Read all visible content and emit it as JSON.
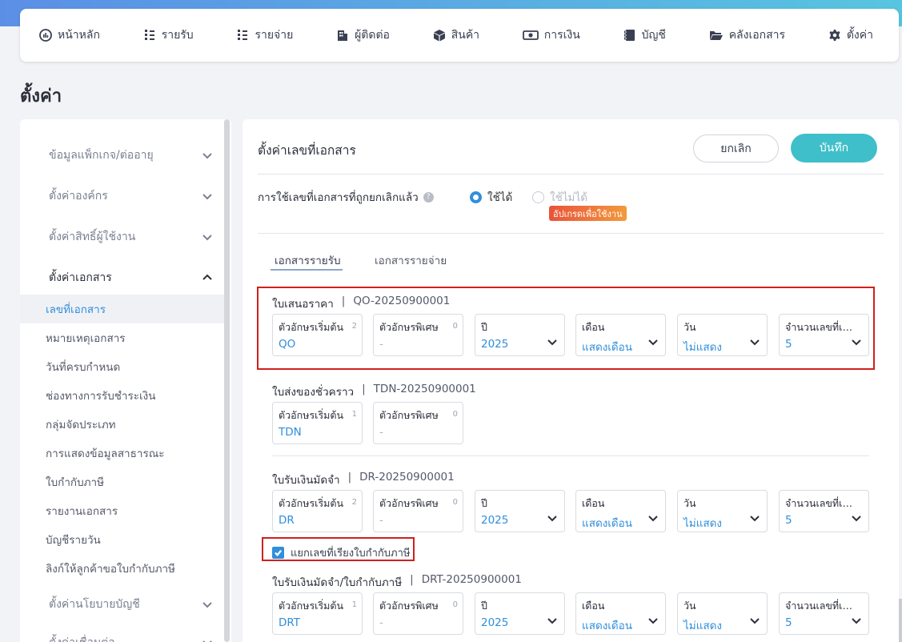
{
  "nav": {
    "items": [
      {
        "label": "หน้าหลัก",
        "icon": "dashboard-icon"
      },
      {
        "label": "รายรับ",
        "icon": "income-icon"
      },
      {
        "label": "รายจ่าย",
        "icon": "expense-icon"
      },
      {
        "label": "ผู้ติดต่อ",
        "icon": "contacts-icon"
      },
      {
        "label": "สินค้า",
        "icon": "box-icon"
      },
      {
        "label": "การเงิน",
        "icon": "money-icon"
      },
      {
        "label": "บัญชี",
        "icon": "book-icon"
      },
      {
        "label": "คลังเอกสาร",
        "icon": "folder-icon"
      },
      {
        "label": "ตั้งค่า",
        "icon": "gear-icon"
      }
    ]
  },
  "page": {
    "title": "ตั้งค่า"
  },
  "sidebar": {
    "groups": [
      {
        "label": "ข้อมูลแพ็กเกจ/ต่ออายุ"
      },
      {
        "label": "ตั้งค่าองค์กร"
      },
      {
        "label": "ตั้งค่าสิทธิ์ผู้ใช้งาน"
      },
      {
        "label": "ตั้งค่าเอกสาร"
      },
      {
        "label": "ตั้งค่านโยบายบัญชี"
      },
      {
        "label": "ตั้งค่าเชื่อมต่อ"
      }
    ],
    "items": [
      {
        "label": "เลขที่เอกสาร"
      },
      {
        "label": "หมายเหตุเอกสาร"
      },
      {
        "label": "วันที่ครบกำหนด"
      },
      {
        "label": "ช่องทางการรับชำระเงิน"
      },
      {
        "label": "กลุ่มจัดประเภท"
      },
      {
        "label": "การแสดงข้อมูลสาธารณะ"
      },
      {
        "label": "ใบกำกับภาษี"
      },
      {
        "label": "รายงานเอกสาร"
      },
      {
        "label": "บัญชีรายวัน"
      },
      {
        "label": "ลิงก์ให้ลูกค้าขอใบกำกับภาษี"
      }
    ]
  },
  "panel": {
    "title": "ตั้งค่าเลขที่เอกสาร",
    "cancel_label": "ยกเลิก",
    "save_label": "บันทึก",
    "reuse_label": "การใช้เลขที่เอกสารที่ถูกยกเลิกแล้ว",
    "help_glyph": "?",
    "radio_yes": "ใช้ได้",
    "radio_no": "ใช้ไม่ได้",
    "upgrade_badge": "อัปเกรดเพื่อใช้งาน",
    "tabs": [
      {
        "label": "เอกสารรายรับ"
      },
      {
        "label": "เอกสารรายจ่าย"
      }
    ],
    "separate_tax_label": "แยกเลขที่เรียงใบกำกับภาษี"
  },
  "fields_labels": {
    "prefix": "ตัวอักษรเริ่มต้น",
    "special": "ตัวอักษรพิเศษ",
    "year": "ปี",
    "month": "เดือน",
    "day": "วัน",
    "running": "จำนวนเลขที่เอกสาร"
  },
  "documents": [
    {
      "name": "ใบเสนอราคา",
      "sep": "|",
      "code": "QO-20250900001",
      "prefix": "QO",
      "prefix_count": "2",
      "special": "-",
      "special_count": "0",
      "year": "2025",
      "month": "แสดงเดือน",
      "day": "ไม่แสดง",
      "running": "5"
    },
    {
      "name": "ใบส่งของชั่วคราว",
      "sep": "|",
      "code": "TDN-20250900001",
      "prefix": "TDN",
      "prefix_count": "1",
      "special": "-",
      "special_count": "0"
    },
    {
      "name": "ใบรับเงินมัดจำ",
      "sep": "|",
      "code": "DR-20250900001",
      "prefix": "DR",
      "prefix_count": "2",
      "special": "-",
      "special_count": "0",
      "year": "2025",
      "month": "แสดงเดือน",
      "day": "ไม่แสดง",
      "running": "5"
    },
    {
      "name": "ใบรับเงินมัดจำ/ใบกำกับภาษี",
      "sep": "|",
      "code": "DRT-20250900001",
      "prefix": "DRT",
      "prefix_count": "1",
      "special": "-",
      "special_count": "0",
      "year": "2025",
      "month": "แสดงเดือน",
      "day": "ไม่แสดง",
      "running": "5"
    }
  ],
  "colors": {
    "accent": "#3fbfc9",
    "link": "#2f8fdc",
    "highlight_border": "#d0201d"
  }
}
